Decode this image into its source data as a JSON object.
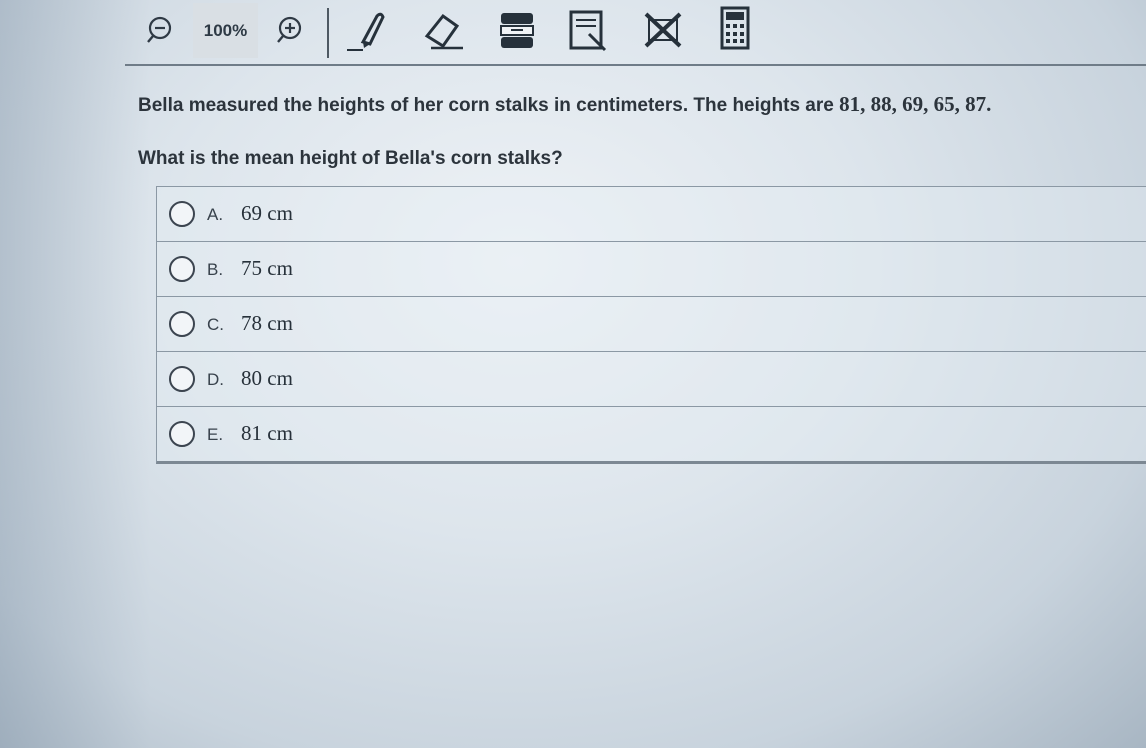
{
  "toolbar": {
    "zoom_level": "100%",
    "tools": [
      "zoom-out-icon",
      "zoom-in-icon",
      "pencil-icon",
      "eraser-icon",
      "line-reader-icon",
      "notes-icon",
      "answer-eliminator-icon",
      "calculator-icon"
    ]
  },
  "question": {
    "text": "Bella measured the heights of her corn stalks in centimeters. The heights are ",
    "values": "81, 88, 69, 65, 87.",
    "prompt": "What is the mean height of Bella's corn stalks?"
  },
  "choices": [
    {
      "letter": "A.",
      "answer": "69 cm"
    },
    {
      "letter": "B.",
      "answer": "75 cm"
    },
    {
      "letter": "C.",
      "answer": "78 cm"
    },
    {
      "letter": "D.",
      "answer": "80 cm"
    },
    {
      "letter": "E.",
      "answer": "81 cm"
    }
  ],
  "colors": {
    "text": "#2c343c",
    "border": "#8b98a4"
  }
}
